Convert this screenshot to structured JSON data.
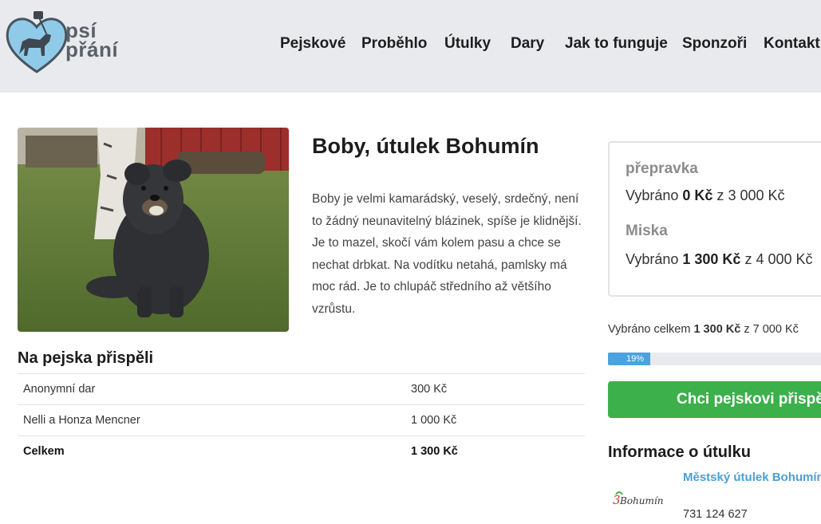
{
  "brand": {
    "line1": "psí",
    "line2": "přání",
    "accent": "#7dbfe3"
  },
  "nav": [
    "Pejskové",
    "Proběhlo",
    "Útulky",
    "Dary",
    "Jak to funguje",
    "Sponzoři",
    "Kontakt"
  ],
  "dog": {
    "title": "Boby, útulek Bohumín",
    "description": "Boby je velmi kamarádský, veselý, srdečný, není to žádný neunavitelný blázinek, spíše je klidnější. Je to mazel, skočí vám kolem pasu a chce se nechat drbkat. Na vodítku netahá, pamlsky má moc rád. Je to chlupáč středního až většího vzrůstu."
  },
  "contributors": {
    "title": "Na pejska přispěli",
    "rows": [
      {
        "name": "Anonymní dar",
        "amount": "300 Kč"
      },
      {
        "name": "Nelli a Honza Mencner",
        "amount": "1 000 Kč"
      }
    ],
    "total": {
      "name": "Celkem",
      "amount": "1 300 Kč"
    }
  },
  "needs": [
    {
      "name": "přepravka",
      "prefix": "Vybráno ",
      "collected": "0 Kč",
      "mid": " z ",
      "goal": "3 000 Kč"
    },
    {
      "name": "Miska",
      "prefix": "Vybráno ",
      "collected": "1 300 Kč",
      "mid": " z ",
      "goal": "4 000 Kč"
    }
  ],
  "summary": {
    "prefix": "Vybráno celkem ",
    "collected": "1 300 Kč",
    "mid": " z ",
    "goal": "7 000 Kč"
  },
  "progress": {
    "value": 0.19,
    "label": "19%",
    "color": "#4aa3df"
  },
  "cta": {
    "label": "Chci pejskovi přispět",
    "color": "#3cb04a"
  },
  "shelter": {
    "title": "Informace o útulku",
    "name": "Městský útulek Bohumín",
    "phone": "731 124 627",
    "logo_text": "Bohumín"
  }
}
